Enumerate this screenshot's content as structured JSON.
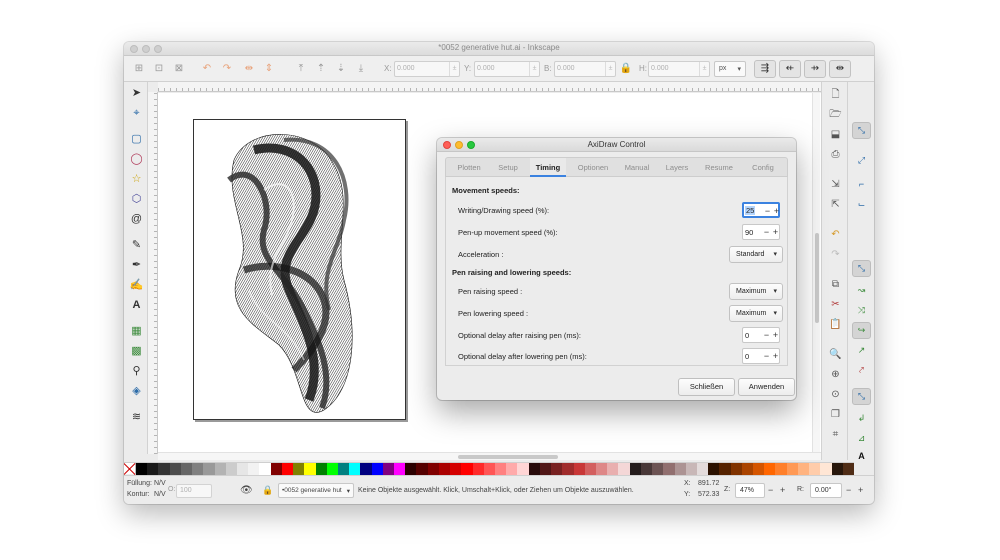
{
  "window": {
    "title": "*0052 generative hut.ai - Inkscape"
  },
  "toolbar": {
    "x_label": "X:",
    "x_value": "0.000",
    "y_label": "Y:",
    "y_value": "0.000",
    "w_label": "B:",
    "w_value": "0.000",
    "h_label": "H:",
    "h_value": "0.000",
    "unit": "px"
  },
  "status": {
    "fill_label": "Füllung:",
    "fill_value": "N/V",
    "stroke_label": "Kontur:",
    "stroke_value": "N/V",
    "opacity_label": "O:",
    "opacity_value": "100",
    "layer": "•0052 generative hut",
    "message": "Keine Objekte ausgewählt. Klick, Umschalt+Klick, oder Ziehen um Objekte auszuwählen.",
    "x_label": "X:",
    "x_value": "891.72",
    "y_label": "Y:",
    "y_value": "572.33",
    "zoom_label": "Z:",
    "zoom_value": "47%",
    "rot_label": "R:",
    "rot_value": "0.00°"
  },
  "dialog": {
    "title": "AxiDraw Control",
    "tabs": [
      {
        "label": "Plotten"
      },
      {
        "label": "Setup"
      },
      {
        "label": "Timing"
      },
      {
        "label": "Optionen"
      },
      {
        "label": "Manual"
      },
      {
        "label": "Layers"
      },
      {
        "label": "Resume"
      },
      {
        "label": "Config"
      }
    ],
    "active_tab": "Timing",
    "section_movement": "Movement speeds:",
    "writing_speed_label": "Writing/Drawing speed (%):",
    "writing_speed_value": "25",
    "penup_speed_label": "Pen-up movement speed (%):",
    "penup_speed_value": "90",
    "acceleration_label": "Acceleration :",
    "acceleration_value": "Standard",
    "section_pen": "Pen raising and lowering speeds:",
    "pen_raising_label": "Pen raising speed :",
    "pen_raising_value": "Maximum",
    "pen_lowering_label": "Pen lowering speed :",
    "pen_lowering_value": "Maximum",
    "delay_raise_label": "Optional delay after raising pen (ms):",
    "delay_raise_value": "0",
    "delay_lower_label": "Optional delay after lowering pen (ms):",
    "delay_lower_value": "0",
    "close_button": "Schließen",
    "apply_button": "Anwenden"
  },
  "palette": [
    "#000000",
    "#1a1a1a",
    "#333333",
    "#4d4d4d",
    "#666666",
    "#808080",
    "#999999",
    "#b3b3b3",
    "#cccccc",
    "#e6e6e6",
    "#f2f2f2",
    "#ffffff",
    "#800000",
    "#ff0000",
    "#808000",
    "#ffff00",
    "#008000",
    "#00ff00",
    "#008080",
    "#00ffff",
    "#000080",
    "#0000ff",
    "#800080",
    "#ff00ff",
    "#2b0000",
    "#550000",
    "#800000",
    "#aa0000",
    "#d40000",
    "#ff0000",
    "#ff2a2a",
    "#ff5555",
    "#ff8080",
    "#ffaaaa",
    "#ffd5d5",
    "#280b0b",
    "#501616",
    "#782121",
    "#a02c2c",
    "#c83737",
    "#d35f5f",
    "#de8787",
    "#e9afaf",
    "#f4d7d7",
    "#241c1c",
    "#483737",
    "#6c5353",
    "#916f6f",
    "#ac9393",
    "#c8b7b7",
    "#e3dbdb",
    "#2b1100",
    "#552200",
    "#803300",
    "#aa4400",
    "#d45500",
    "#ff6600",
    "#ff7f2a",
    "#ff9955",
    "#ffb380",
    "#ffccaa",
    "#ffe6d5",
    "#28170b",
    "#502d16"
  ]
}
